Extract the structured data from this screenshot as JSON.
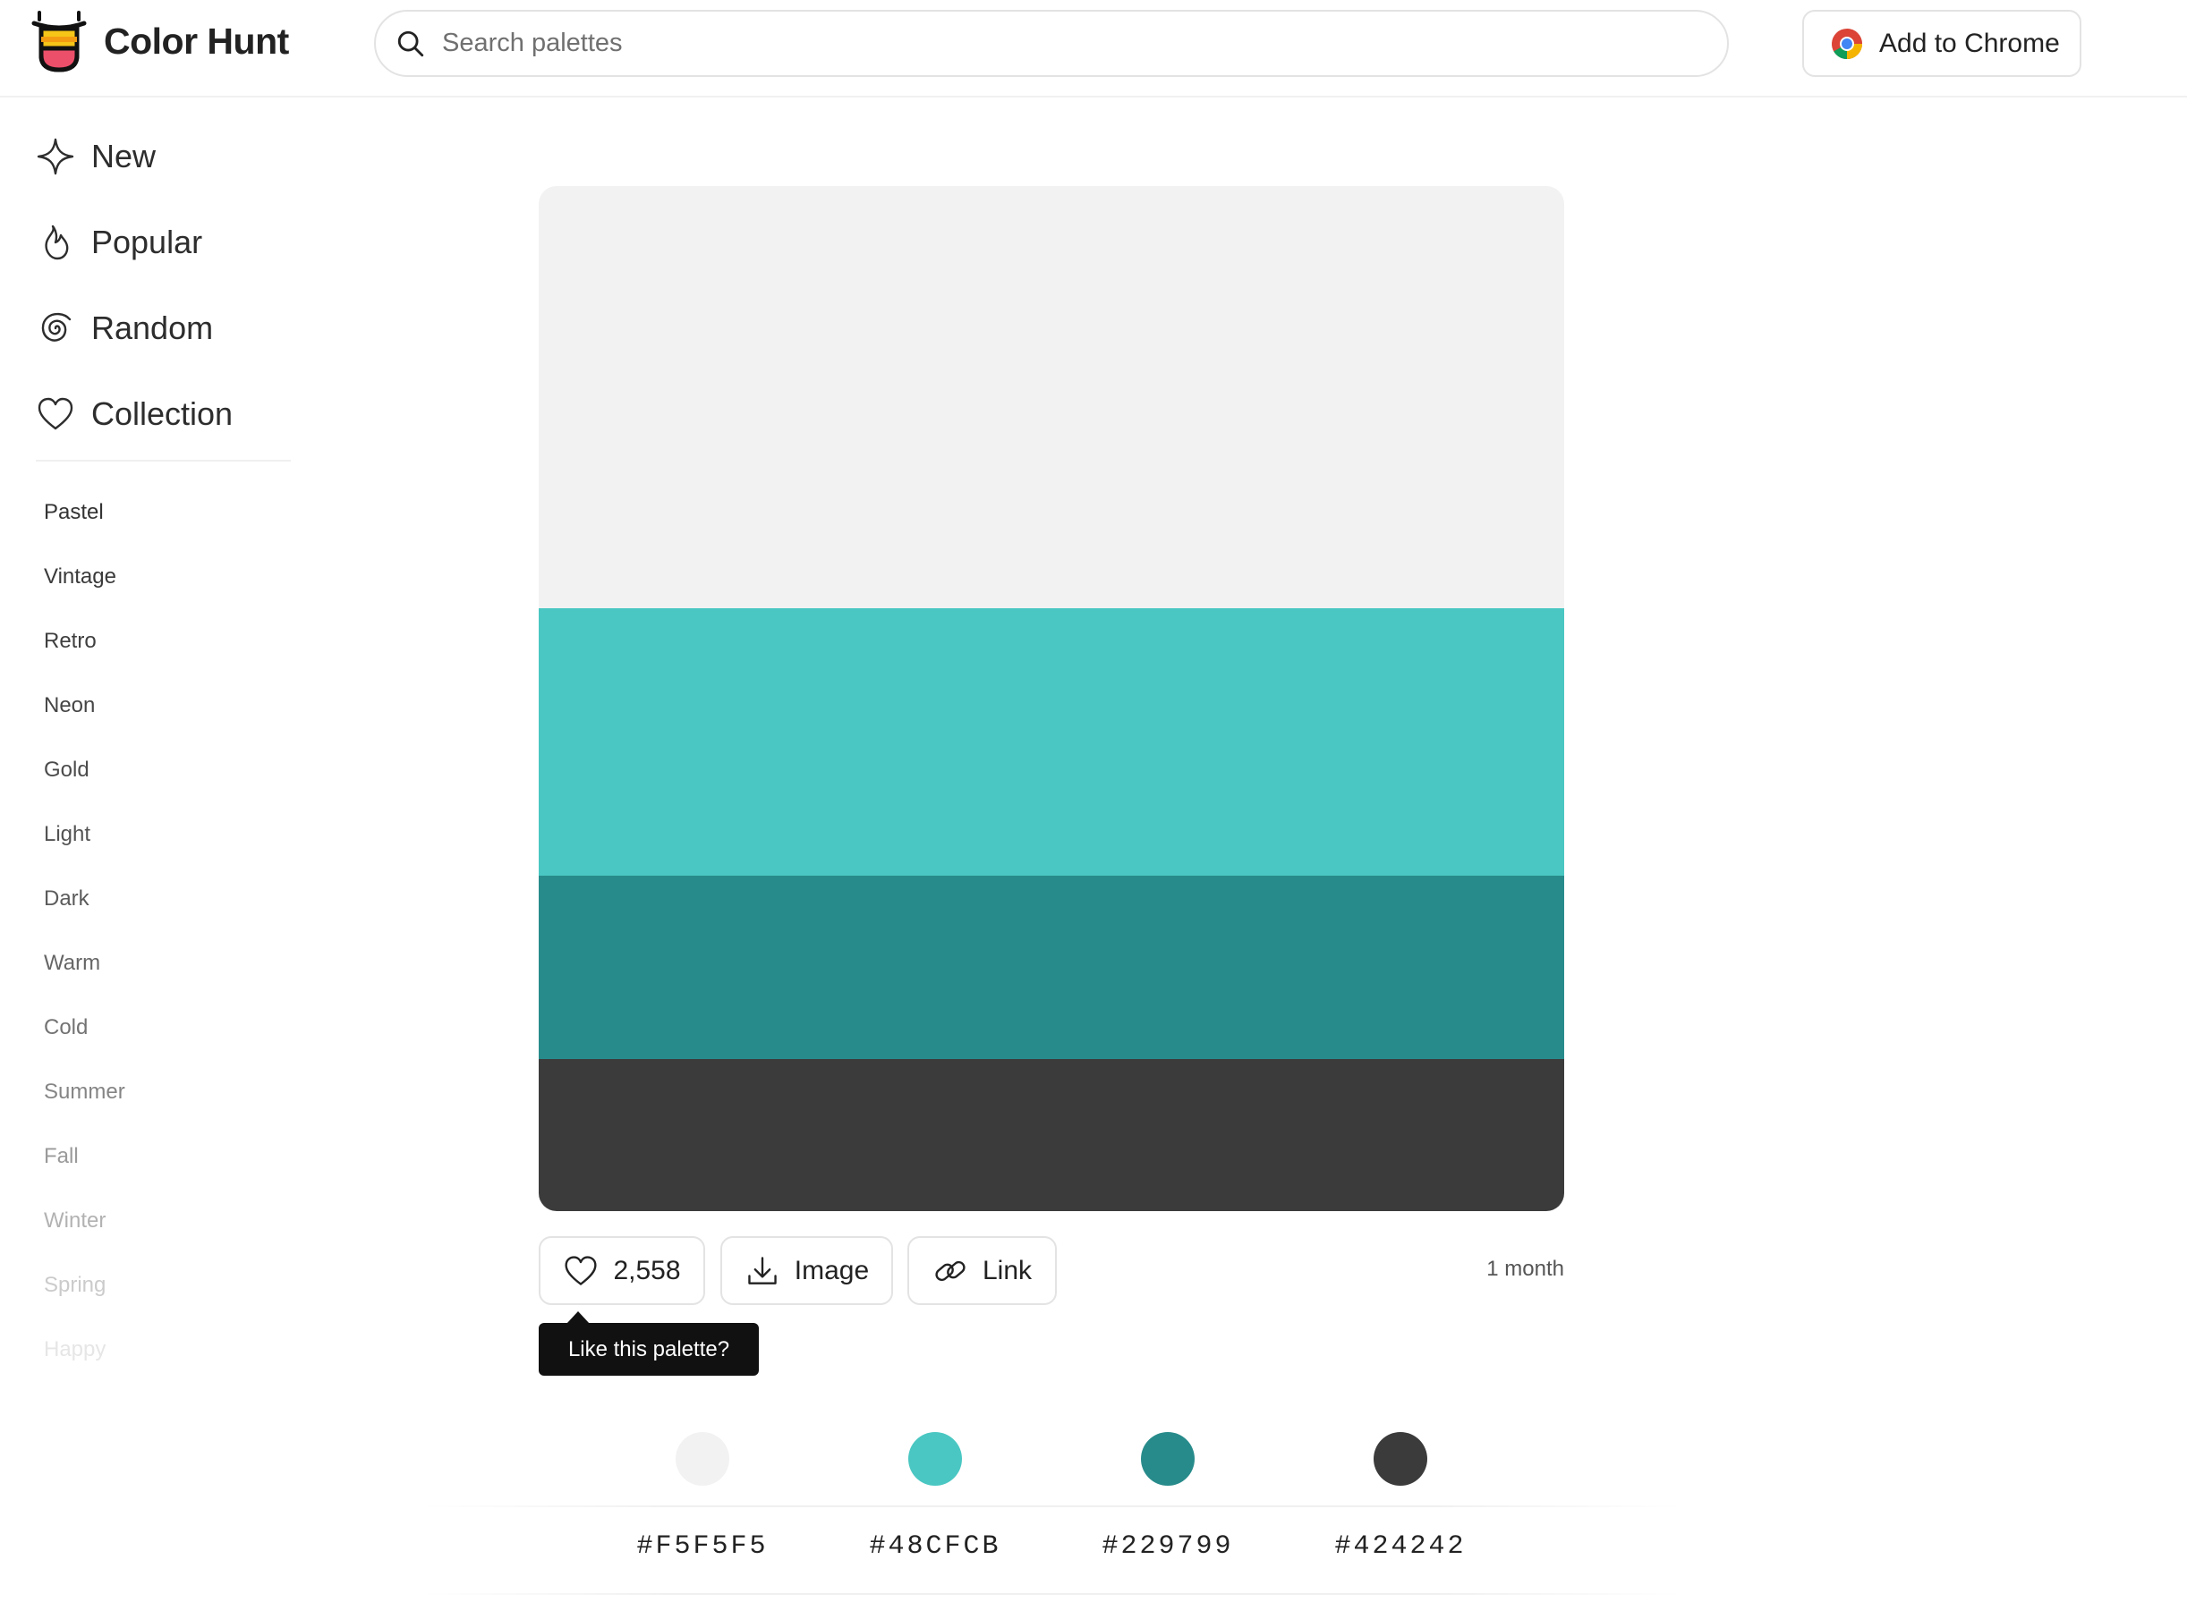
{
  "app": {
    "name": "Color Hunt"
  },
  "search": {
    "placeholder": "Search palettes",
    "value": ""
  },
  "header": {
    "chrome_button": "Add to Chrome"
  },
  "sidebar": {
    "nav": [
      {
        "label": "New",
        "icon": "sparkle-icon"
      },
      {
        "label": "Popular",
        "icon": "flame-icon"
      },
      {
        "label": "Random",
        "icon": "spiral-icon"
      },
      {
        "label": "Collection",
        "icon": "heart-icon"
      }
    ],
    "tags": [
      {
        "label": "Pastel",
        "color": "#333333"
      },
      {
        "label": "Vintage",
        "color": "#3a3a3a"
      },
      {
        "label": "Retro",
        "color": "#3f3f3f"
      },
      {
        "label": "Neon",
        "color": "#454545"
      },
      {
        "label": "Gold",
        "color": "#4b4b4b"
      },
      {
        "label": "Light",
        "color": "#535353"
      },
      {
        "label": "Dark",
        "color": "#5b5b5b"
      },
      {
        "label": "Warm",
        "color": "#666666"
      },
      {
        "label": "Cold",
        "color": "#737373"
      },
      {
        "label": "Summer",
        "color": "#858585"
      },
      {
        "label": "Fall",
        "color": "#9a9a9a"
      },
      {
        "label": "Winter",
        "color": "#b2b2b2"
      },
      {
        "label": "Spring",
        "color": "#cbcbcb"
      },
      {
        "label": "Happy",
        "color": "#e6e6e6"
      }
    ]
  },
  "palette": {
    "colors": [
      "#F5F5F5",
      "#48CFCB",
      "#229799",
      "#424242"
    ],
    "display_colors": [
      "#f2f2f2",
      "#4ac7c2",
      "#288b8b",
      "#3b3b3b"
    ],
    "likes": "2,558",
    "image_label": "Image",
    "link_label": "Link",
    "age": "1 month",
    "tooltip": "Like this palette?"
  }
}
